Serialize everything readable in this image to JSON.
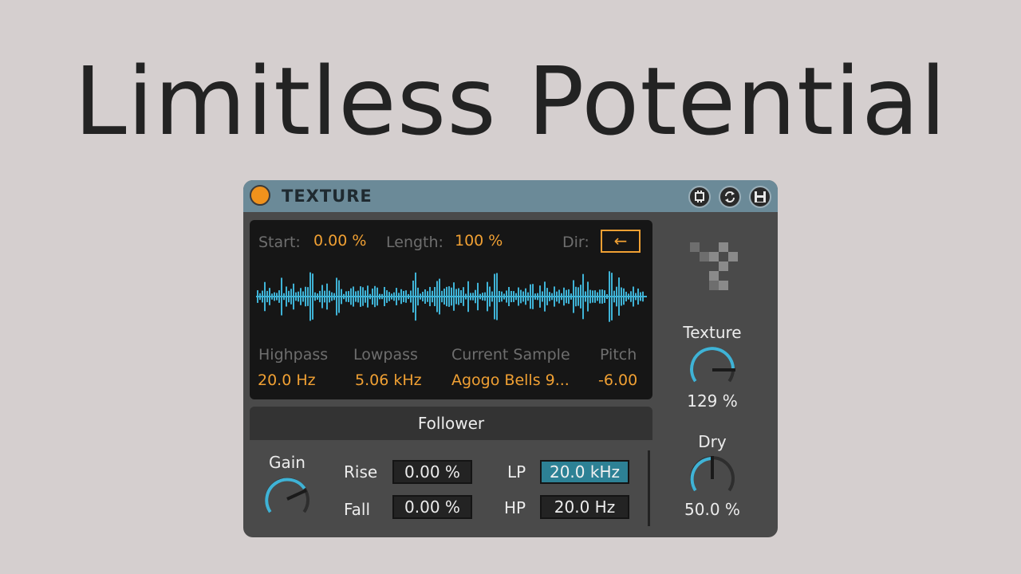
{
  "headline": "Limitless Potential",
  "device": {
    "title": "TEXTURE",
    "toolbar_icons": [
      "hotswap-icon",
      "refresh-icon",
      "save-icon"
    ]
  },
  "display": {
    "start_label": "Start:",
    "start_value": "0.00 %",
    "length_label": "Length:",
    "length_value": "100 %",
    "dir_label": "Dir:",
    "dir_value": "←",
    "highpass_label": "Highpass",
    "highpass_value": "20.0 Hz",
    "lowpass_label": "Lowpass",
    "lowpass_value": "5.06 kHz",
    "sample_label": "Current Sample",
    "sample_value": "Agogo Bells 9...",
    "pitch_label": "Pitch",
    "pitch_value": "-6.00"
  },
  "follower": {
    "title": "Follower",
    "gain_label": "Gain",
    "rise_label": "Rise",
    "rise_value": "0.00 %",
    "fall_label": "Fall",
    "fall_value": "0.00 %",
    "lp_label": "LP",
    "lp_value": "20.0 kHz",
    "hp_label": "HP",
    "hp_value": "20.0 Hz"
  },
  "texture_knob": {
    "label": "Texture",
    "value": "129 %"
  },
  "dry_knob": {
    "label": "Dry",
    "value": "50.0 %"
  },
  "colors": {
    "accent_orange": "#f0a033",
    "knob_arc": "#3fb3d6",
    "waveform": "#3fb3d6",
    "title_bar": "#6b8a98"
  }
}
